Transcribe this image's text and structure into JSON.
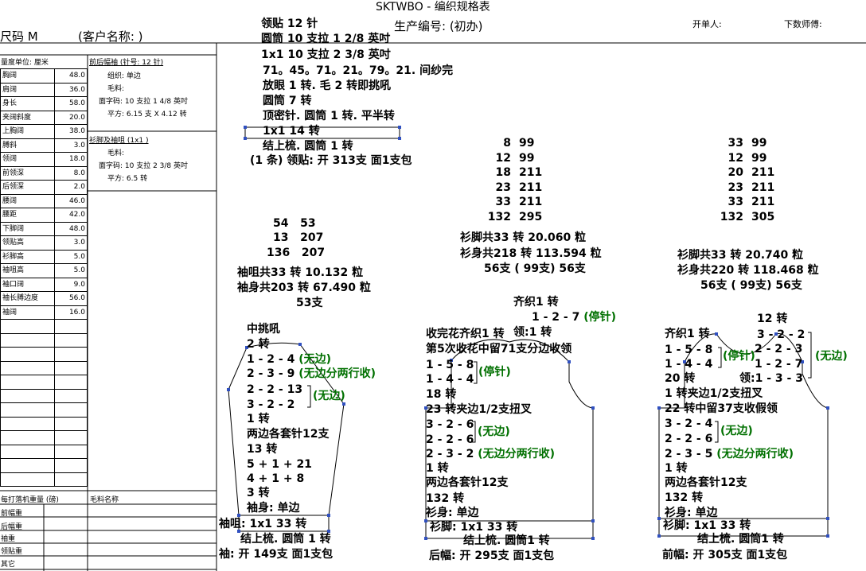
{
  "header": {
    "title": "SKTWBO - 编织规格表",
    "size": "尺码  M",
    "customer": "(客户名称:                 )",
    "production_no": "生产编号: (初办)",
    "opener": "开单人:",
    "calc_master": "下数师傅:"
  },
  "measurements": {
    "unit_label": "量度单位: 厘米",
    "rows": [
      {
        "name": "胸阔",
        "value": "48.0"
      },
      {
        "name": "肩阔",
        "value": "36.0"
      },
      {
        "name": "身长",
        "value": "58.0"
      },
      {
        "name": "夹阔斜度",
        "value": "20.0"
      },
      {
        "name": "上胸阔",
        "value": "38.0"
      },
      {
        "name": "膊斜",
        "value": "3.0"
      },
      {
        "name": "领阔",
        "value": "18.0"
      },
      {
        "name": "前领深",
        "value": "8.0"
      },
      {
        "name": "后领深",
        "value": "2.0"
      },
      {
        "name": "腰阔",
        "value": "46.0"
      },
      {
        "name": "腰距",
        "value": "42.0"
      },
      {
        "name": "下脚阔",
        "value": "48.0"
      },
      {
        "name": "领贴高",
        "value": "3.0"
      },
      {
        "name": "衫脚高",
        "value": "5.0"
      },
      {
        "name": "袖咀高",
        "value": "5.0"
      },
      {
        "name": "袖口阔",
        "value": "9.0"
      },
      {
        "name": "袖长膊边度",
        "value": "56.0"
      },
      {
        "name": "袖阔",
        "value": "16.0"
      }
    ]
  },
  "specs": {
    "body_title": "前后幅袖 (针号: 12 针)",
    "body_org": "组织: 单边",
    "body_yarn": "毛料:",
    "body_tension": "面字码: 10 支拉 1 4/8 英吋",
    "body_square": "平方: 6.15 支 X  4.12 转",
    "rib_title": "衫脚及袖咀 (1x1 )",
    "rib_yarn": "毛料:",
    "rib_tension": "面字码: 10 支拉 2 3/8 英吋",
    "rib_square": "平方: 6.5 转"
  },
  "bottom_table": {
    "weight_label": "每打落机重量 (磅)",
    "yarn_name": "毛料名称",
    "rows": [
      "前幅重",
      "后幅重",
      "袖重",
      "领贴重",
      "其它"
    ]
  },
  "collar_notes": [
    "领贴  12 针",
    "圆筒 10 支拉 1 2/8 英吋",
    "1x1   10 支拉 2 3/8 英吋",
    "71。45。71。21。79。21. 间纱完",
    "放眼 1 转. 毛 2 转即挑吼",
    "圆筒      7 转",
    "顶密针. 圆筒 1 转. 平半转",
    "1x1        14 转",
    "结上梳. 圆筒 1 转",
    "(1 条) 领贴: 开 313支 面1支包"
  ],
  "sleeve": {
    "table": [
      [
        "54",
        "53"
      ],
      [
        "13",
        "207"
      ],
      [
        "136",
        "207"
      ]
    ],
    "summary": [
      "袖咀共33 转 10.132 粒",
      "袖身共203 转 67.490 粒",
      "53支"
    ],
    "top": "中挑吼",
    "steps": [
      "2 转",
      "1 - 2 - 4",
      "2 - 3 - 9",
      "2 - 2 - 13",
      "3 - 2 - 2",
      "1 转",
      "两边各套针12支",
      "13 转",
      "5 + 1 + 21",
      "4 + 1 + 8",
      "3 转",
      "袖身: 单边"
    ],
    "wubian1": "(无边)",
    "wubian2": "(无边分两行收)",
    "wubian3": "(无边)",
    "cuff": "袖咀: 1x1     33 转",
    "finish": "结上梳. 圆筒 1 转",
    "open": "袖: 开  149支  面1支包"
  },
  "back": {
    "table": [
      [
        "8",
        "99"
      ],
      [
        "12",
        "99"
      ],
      [
        "18",
        "211"
      ],
      [
        "23",
        "211"
      ],
      [
        "33",
        "211"
      ],
      [
        "132",
        "295"
      ]
    ],
    "summary": [
      "衫脚共33 转 20.060 粒",
      "衫身共218 转 113.594 粒",
      "56支 ( 99支) 56支"
    ],
    "top1": "齐织1 转",
    "top2": "1 - 2 - 7",
    "tingzhen": "(停针)",
    "neck1": "收完花齐织1 转",
    "neck_side": "领:1 转",
    "neck2": "第5次收花中留71支分边收领",
    "s1": "1 - 5 - 8",
    "s2": "1 - 4 - 4",
    "tingzhen2": "(停针)",
    "s3": "18 转",
    "s4": "23 转夹边1/2支扭叉",
    "s5": "3 - 2 - 6",
    "s6": "2 - 2 - 6",
    "wubian": "(无边)",
    "s7": "2 - 3 - 2",
    "wubian2": "(无边分两行收)",
    "s8": "1 转",
    "s9": "两边各套针12支",
    "s10": "132 转",
    "s11": "衫身: 单边",
    "hem": "衫脚: 1x1     33 转",
    "finish": "结上梳. 圆筒1 转",
    "open": "后幅: 开  295支  面1支包"
  },
  "front": {
    "table": [
      [
        "33",
        "99"
      ],
      [
        "12",
        "99"
      ],
      [
        "20",
        "211"
      ],
      [
        "23",
        "211"
      ],
      [
        "33",
        "211"
      ],
      [
        "132",
        "305"
      ]
    ],
    "summary": [
      "衫脚共33 转 20.740 粒",
      "衫身共220 转 118.468 粒",
      "56支 ( 99支) 56支"
    ],
    "t12": "12 转",
    "top1": "齐织1 转",
    "n1": "3 - 2 - 2",
    "n2": "2 - 2 - 3",
    "n3": "1 - 2 - 7",
    "wubian_r": "(无边)",
    "s1": "1 - 5 - 8",
    "s2": "1 - 4 - 4",
    "tingzhen": "(停针)",
    "s3": "20 转",
    "neck": "领:1 - 3 - 3",
    "s4": "1 转夹边1/2支扭叉",
    "s5": "22 转中留37支收假领",
    "s6": "3 - 2 - 4",
    "s7": "2 - 2 - 6",
    "wubian": "(无边)",
    "s8": "2 - 3 - 5",
    "wubian2": "(无边分两行收)",
    "s9": "1 转",
    "s10": "两边各套针12支",
    "s11": "132 转",
    "s12": "衫身: 单边",
    "hem": "衫脚: 1x1     33 转",
    "finish": "结上梳. 圆筒1 转",
    "open": "前幅: 开  305支  面1支包"
  }
}
